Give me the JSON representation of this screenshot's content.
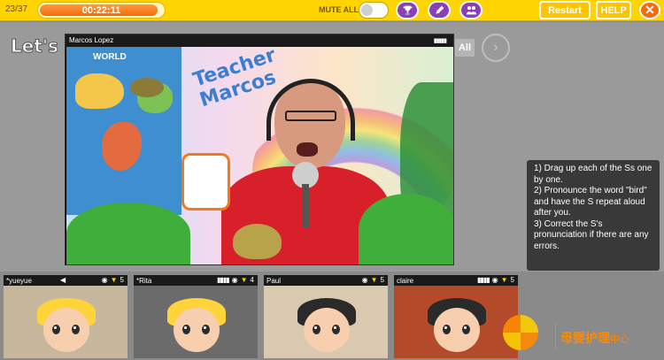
{
  "topbar": {
    "page_counter": "23/37",
    "timer": "00:22:11",
    "timer_progress": 0.95,
    "mute_all_label": "MUTE ALL",
    "restart_label": "Restart",
    "help_label": "HELP",
    "close_symbol": "✕",
    "icons": [
      "trophy-icon",
      "pencil-icon",
      "group-icon"
    ],
    "accent_color": "#ffd400",
    "button_color": "#8a3fb8"
  },
  "lesson": {
    "title_fragment": "Let's",
    "all_tab_label": "All",
    "next_symbol": "›"
  },
  "main_video": {
    "name": "Marcos Lopez",
    "signal": "▮▮▮▮▮",
    "sign_text": "Teacher Marcos",
    "map_label": "WORLD"
  },
  "instructions": {
    "lines": [
      "1) Drag up each of the Ss one by one.",
      "2) Pronounce the word \"bird\" and have the S repeat aloud after you.",
      "3) Correct the S's pronunciation if there are any errors."
    ]
  },
  "students": [
    {
      "name": "*yueyue",
      "trophies": "5",
      "hair_color": "#ffd33a",
      "bg": "#c7b79c"
    },
    {
      "name": "*Rita",
      "trophies": "4",
      "hair_color": "#ffd33a",
      "bg": "#6b6b6b"
    },
    {
      "name": "Paul",
      "trophies": "5",
      "hair_color": "#2a2a2a",
      "bg": "#d9c9b1"
    },
    {
      "name": "claire",
      "trophies": "5",
      "hair_color": "#2a2a2a",
      "bg": "#b34a2a"
    }
  ],
  "watermark": {
    "text": "母婴护理",
    "sub": "中心"
  }
}
